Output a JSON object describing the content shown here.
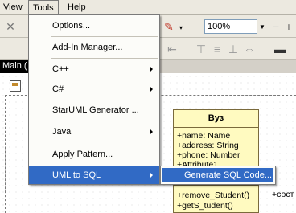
{
  "menubar": {
    "view": "View",
    "tools": "Tools",
    "help": "Help"
  },
  "toolbar": {
    "zoom_value": "100%"
  },
  "tabs": {
    "main": "Main ("
  },
  "tools_menu": {
    "items": [
      {
        "label": "Options...",
        "has_submenu": false
      },
      {
        "label": "Add-In Manager...",
        "has_submenu": false
      },
      {
        "label": "C++",
        "has_submenu": true
      },
      {
        "label": "C#",
        "has_submenu": true
      },
      {
        "label": "StarUML Generator ...",
        "has_submenu": false
      },
      {
        "label": "Java",
        "has_submenu": true
      },
      {
        "label": "Apply Pattern...",
        "has_submenu": false
      },
      {
        "label": "UML to SQL",
        "has_submenu": true
      }
    ]
  },
  "submenu": {
    "item": "Generate SQL Code..."
  },
  "class_box": {
    "name": "Вуз",
    "attributes": [
      "+name: Name",
      "+address: String",
      "+phone: Number",
      "+Attribute1"
    ],
    "operations": [
      "+remove_Student()",
      "+getS_tudent()"
    ]
  },
  "side_label": "+сост",
  "colors": {
    "highlight": "#316ac5",
    "class_fill": "#fffac0"
  }
}
